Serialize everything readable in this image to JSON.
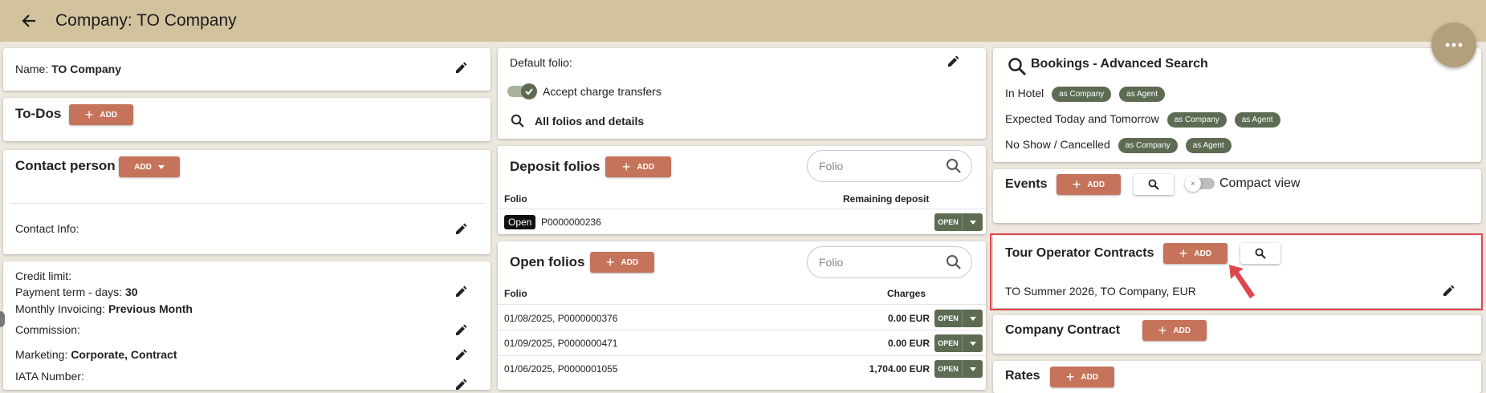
{
  "header": {
    "title": "Company: TO Company"
  },
  "left": {
    "name_label": "Name:",
    "name_value": "TO Company",
    "todos_title": "To-Dos",
    "todos_add": "ADD",
    "contact_title": "Contact person",
    "contact_add": "ADD",
    "contact_info_label": "Contact Info:",
    "credit_limit_label": "Credit limit:",
    "payment_term_label": "Payment term - days:",
    "payment_term_value": "30",
    "monthly_invoicing_label": "Monthly Invoicing:",
    "monthly_invoicing_value": "Previous Month",
    "commission_label": "Commission:",
    "marketing_label": "Marketing:",
    "marketing_value": "Corporate, Contract",
    "iata_label": "IATA Number:"
  },
  "middle": {
    "default_folio_label": "Default folio:",
    "accept_transfers_label": "Accept charge transfers",
    "accept_transfers_on": true,
    "all_folios_label": "All folios and details",
    "deposit": {
      "title": "Deposit folios",
      "add": "ADD",
      "search_placeholder": "Folio",
      "col_folio": "Folio",
      "col_amount": "Remaining deposit",
      "rows": [
        {
          "badge": "Open",
          "folio": "P0000000236",
          "action": "OPEN"
        }
      ]
    },
    "open": {
      "title": "Open folios",
      "add": "ADD",
      "search_placeholder": "Folio",
      "col_folio": "Folio",
      "col_amount": "Charges",
      "rows": [
        {
          "folio": "01/08/2025,  P0000000376",
          "amount": "0.00 EUR",
          "action": "OPEN"
        },
        {
          "folio": "01/09/2025,  P0000000471",
          "amount": "0.00 EUR",
          "action": "OPEN"
        },
        {
          "folio": "01/06/2025,  P0000001055",
          "amount": "1,704.00 EUR",
          "action": "OPEN"
        }
      ]
    }
  },
  "right": {
    "bookings_title": "Bookings - Advanced Search",
    "in_hotel": "In Hotel",
    "expected": "Expected Today and Tomorrow",
    "no_show": "No Show / Cancelled",
    "chip_company": "as Company",
    "chip_agent": "as Agent",
    "events_title": "Events",
    "events_add": "ADD",
    "compact_view": "Compact view",
    "toc_title": "Tour Operator Contracts",
    "toc_add": "ADD",
    "toc_item": "TO Summer 2026, TO Company, EUR",
    "company_contract_title": "Company Contract",
    "company_contract_add": "ADD",
    "rates_title": "Rates",
    "rates_add": "ADD"
  },
  "colors": {
    "header_bg": "#d2c29e",
    "add_button": "#c5735a",
    "green": "#5c6b52",
    "highlight": "#e0464e"
  }
}
